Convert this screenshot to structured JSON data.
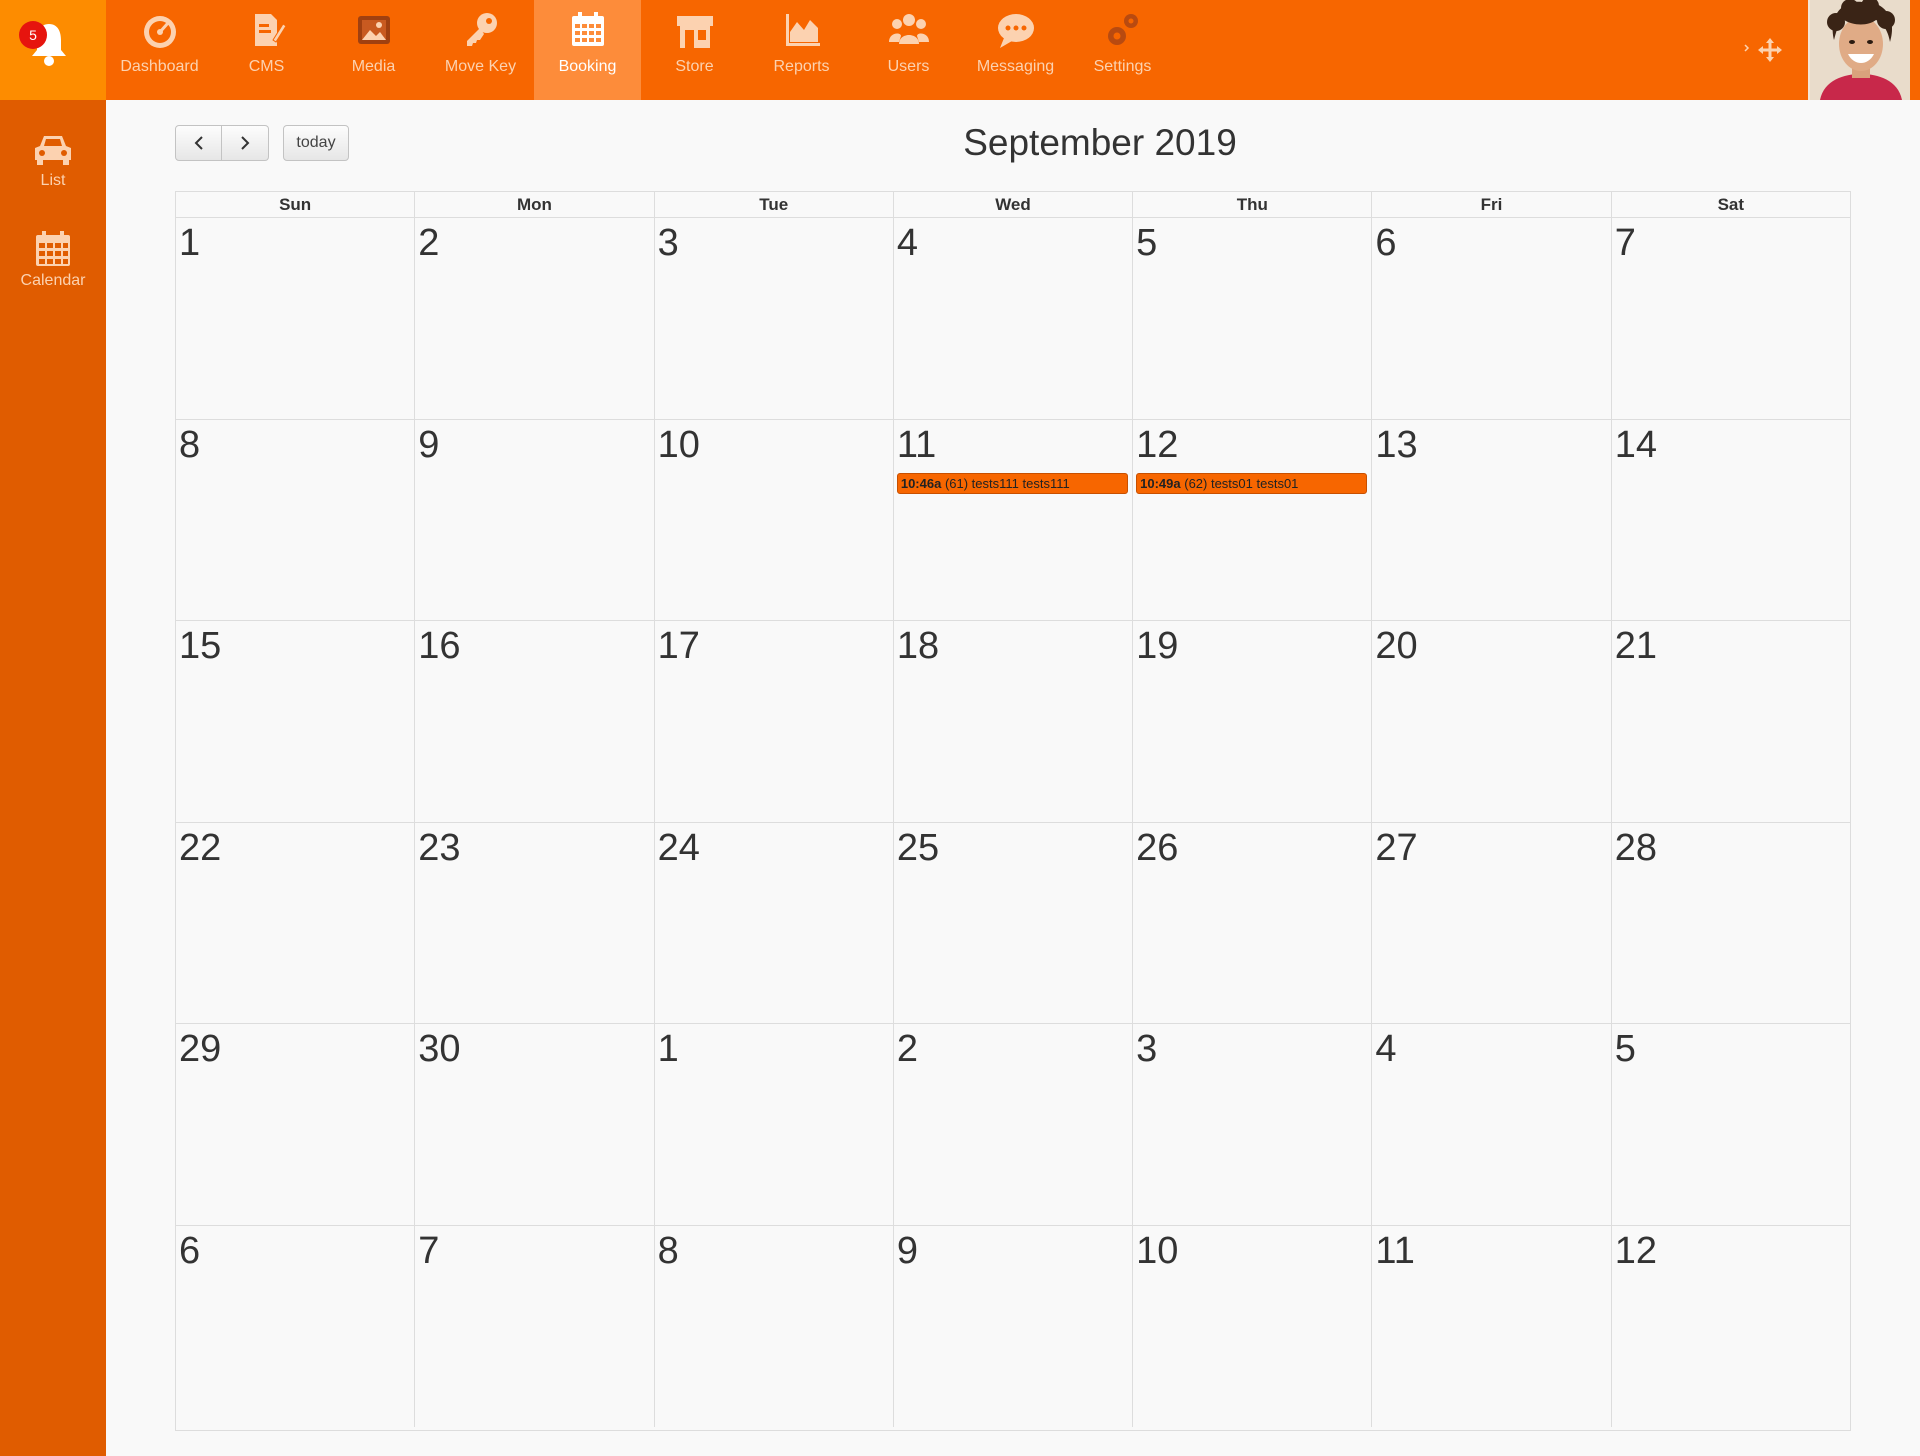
{
  "notifications": {
    "count": "5"
  },
  "nav": [
    {
      "label": "Dashboard",
      "icon": "dashboard-icon"
    },
    {
      "label": "CMS",
      "icon": "cms-icon"
    },
    {
      "label": "Media",
      "icon": "media-icon"
    },
    {
      "label": "Move Key",
      "icon": "key-icon"
    },
    {
      "label": "Booking",
      "icon": "calendar-icon",
      "active": true
    },
    {
      "label": "Store",
      "icon": "store-icon"
    },
    {
      "label": "Reports",
      "icon": "reports-icon"
    },
    {
      "label": "Users",
      "icon": "users-icon"
    },
    {
      "label": "Messaging",
      "icon": "messaging-icon"
    },
    {
      "label": "Settings",
      "icon": "settings-icon"
    }
  ],
  "sidebar": [
    {
      "label": "List",
      "icon": "car-icon"
    },
    {
      "label": "Calendar",
      "icon": "calendar-icon"
    }
  ],
  "toolbar": {
    "today_label": "today"
  },
  "calendar": {
    "title": "September 2019",
    "weekdays": [
      "Sun",
      "Mon",
      "Tue",
      "Wed",
      "Thu",
      "Fri",
      "Sat"
    ],
    "weeks": [
      [
        "1",
        "2",
        "3",
        "4",
        "5",
        "6",
        "7"
      ],
      [
        "8",
        "9",
        "10",
        "11",
        "12",
        "13",
        "14"
      ],
      [
        "15",
        "16",
        "17",
        "18",
        "19",
        "20",
        "21"
      ],
      [
        "22",
        "23",
        "24",
        "25",
        "26",
        "27",
        "28"
      ],
      [
        "29",
        "30",
        "1",
        "2",
        "3",
        "4",
        "5"
      ],
      [
        "6",
        "7",
        "8",
        "9",
        "10",
        "11",
        "12"
      ]
    ],
    "events": [
      {
        "week": 1,
        "day": 3,
        "time": "10:46a",
        "text": "(61) tests111 tests111"
      },
      {
        "week": 1,
        "day": 4,
        "time": "10:49a",
        "text": "(62) tests01 tests01"
      }
    ]
  },
  "colors": {
    "accent": "#f76600",
    "sidebar": "#e05c00",
    "bell_box": "#fd8c00",
    "active_tab": "#fd8c3a",
    "badge": "#e6140e"
  }
}
